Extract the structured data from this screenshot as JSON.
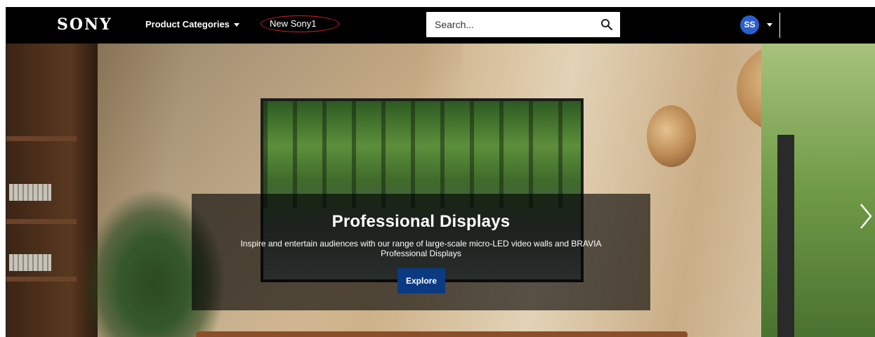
{
  "header": {
    "logo": "SONY",
    "nav_categories_label": "Product Categories",
    "nav_highlight_label": "New Sony1",
    "search_placeholder": "Search...",
    "avatar_initials": "SS"
  },
  "hero": {
    "title": "Professional Displays",
    "description": "Inspire and entertain audiences with our range of large-scale micro-LED video walls and BRAVIA Professional Displays",
    "button_label": "Explore"
  },
  "icons": {
    "search": "search-icon",
    "caret": "chevron-down-icon",
    "next": "chevron-right-icon"
  },
  "colors": {
    "nav_background": "#000000",
    "avatar": "#2b5fce",
    "explore_button": "#0a3a82",
    "highlight_outline": "#d4202a"
  }
}
